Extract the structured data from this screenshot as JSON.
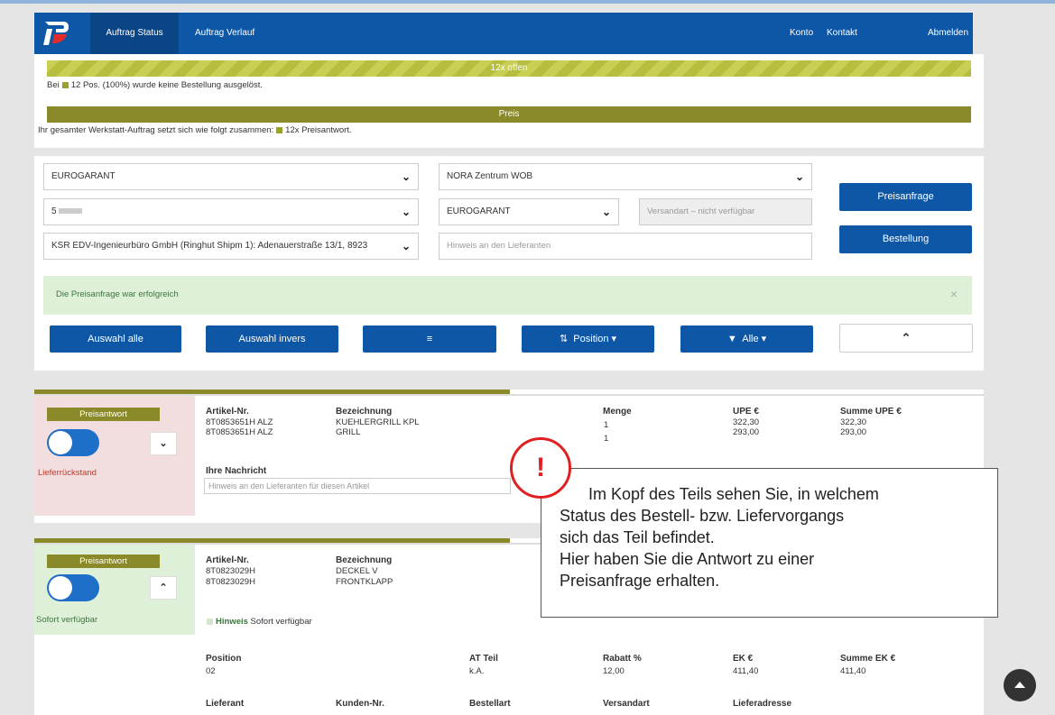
{
  "nav": {
    "items": {
      "status": "Auftrag Status",
      "history": "Auftrag Verlauf",
      "account": "Konto",
      "contact": "Kontakt",
      "logout": "Abmelden"
    }
  },
  "status": {
    "open_bar": "12x offen",
    "open_text_pre": "Bei",
    "open_text_post": "12 Pos. (100%) wurde keine Bestellung ausgelöst.",
    "price_bar": "Preis",
    "price_text_pre": "Ihr gesamter Werkstatt-Auftrag setzt sich wie folgt zusammen:",
    "price_text_post": "12x Preisantwort."
  },
  "form": {
    "select_brand": "EUROGARANT",
    "select_center": "NORA Zentrum WOB",
    "select_customer": "5",
    "select_supplier": "EUROGARANT",
    "shipping_placeholder": "Versandart – nicht verfügbar",
    "select_address": "KSR EDV-Ingenieurbüro GmbH (Ringhut Shipm 1): Adenauerstraße 13/1, 8923",
    "hint_placeholder": "Hinweis an den Lieferanten",
    "btn_price_request": "Preisanfrage",
    "btn_order": "Bestellung"
  },
  "alert": {
    "message": "Die Preisanfrage war erfolgreich",
    "close": "×"
  },
  "toolbar": {
    "select_all": "Auswahl alle",
    "select_invert": "Auswahl invers",
    "sort_icon": "≡",
    "position": "Position",
    "filter": "Alle"
  },
  "item1": {
    "badge": "Preisantwort",
    "status": "Lieferrückstand",
    "h_art": "Artikel-Nr.",
    "h_desc": "Bezeichnung",
    "h_qty": "Menge",
    "h_upe": "UPE €",
    "h_sum": "Summe UPE €",
    "rows": [
      {
        "art": "8T0853651H ALZ",
        "desc": "KUEHLERGRILL KPL",
        "qty": "1",
        "upe": "322,30",
        "sum": "322,30"
      },
      {
        "art": "8T0853651H ALZ",
        "desc": "GRILL",
        "qty": "1",
        "upe": "293,00",
        "sum": "293,00"
      }
    ],
    "msg_label": "Ihre Nachricht",
    "msg_placeholder": "Hinweis an den Lieferanten für diesen Artikel"
  },
  "item2": {
    "badge": "Preisantwort",
    "status": "Sofort verfügbar",
    "h_art": "Artikel-Nr.",
    "h_desc": "Bezeichnung",
    "rows": [
      {
        "art": "8T0823029H",
        "desc": "DECKEL V"
      },
      {
        "art": "8T0823029H",
        "desc": "FRONTKLAPP"
      }
    ],
    "hint_label": "Hinweis",
    "hint_text": "Sofort verfügbar",
    "h_pos": "Position",
    "pos": "02",
    "h_at": "AT Teil",
    "at": "k.A.",
    "h_rabatt": "Rabatt %",
    "rabatt": "12,00",
    "h_ek": "EK €",
    "ek": "411,40",
    "h_sumek": "Summe EK €",
    "sumek": "411,40",
    "h_lieferant": "Lieferant",
    "h_kunden": "Kunden-Nr.",
    "h_bestellart": "Bestellart",
    "h_versandart": "Versandart",
    "h_lieferadresse": "Lieferadresse"
  },
  "callout": {
    "mark": "!",
    "line1": "Im Kopf des Teils sehen Sie, in welchem",
    "line2": "Status des Bestell- bzw. Liefervorgangs",
    "line3": "sich das Teil befindet.",
    "line4": "Hier haben Sie die Antwort zu einer",
    "line5": "Preisanfrage erhalten."
  },
  "colors": {
    "brand_blue": "#0d57a6",
    "olive": "#8a8a2a",
    "lime": "#c8cf54",
    "backorder_bg": "#f2dede",
    "available_bg": "#dff0d8"
  }
}
